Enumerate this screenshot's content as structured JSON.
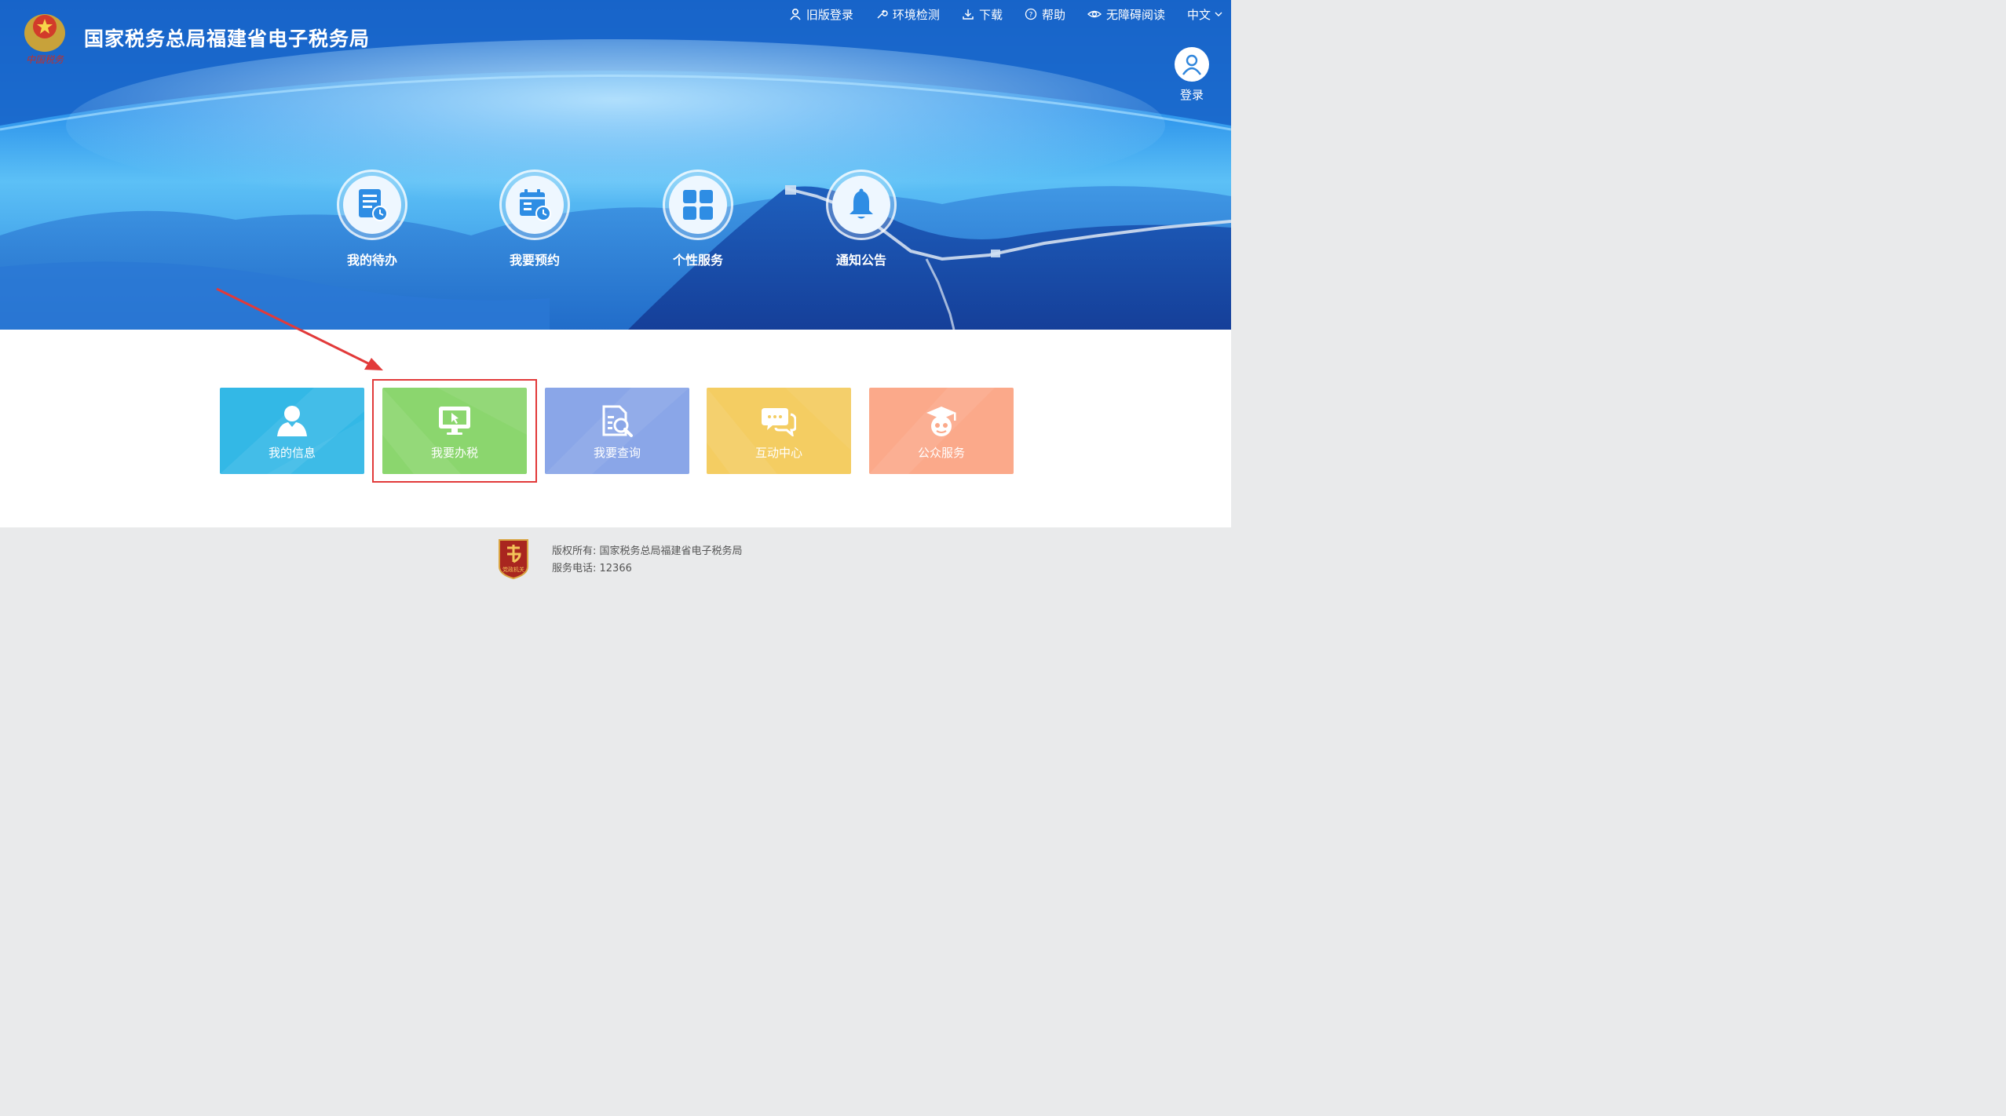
{
  "header": {
    "site_title": "国家税务总局福建省电子税务局",
    "logo_caption": "中国税务"
  },
  "topnav": {
    "old_login": "旧版登录",
    "env_check": "环境检测",
    "download": "下载",
    "help": "帮助",
    "accessibility": "无障碍阅读",
    "language": "中文"
  },
  "login": {
    "label": "登录"
  },
  "quick_links": [
    {
      "label": "我的待办",
      "icon": "todo-list-icon"
    },
    {
      "label": "我要预约",
      "icon": "calendar-clock-icon"
    },
    {
      "label": "个性服务",
      "icon": "grid-apps-icon"
    },
    {
      "label": "通知公告",
      "icon": "bell-icon"
    }
  ],
  "tiles": [
    {
      "label": "我的信息",
      "icon": "user-icon",
      "color": "#33b8e6"
    },
    {
      "label": "我要办税",
      "icon": "monitor-cursor-icon",
      "color": "#8bd66e"
    },
    {
      "label": "我要查询",
      "icon": "document-search-icon",
      "color": "#8aa6e8"
    },
    {
      "label": "互动中心",
      "icon": "chat-bubbles-icon",
      "color": "#f4cd62"
    },
    {
      "label": "公众服务",
      "icon": "graduate-face-icon",
      "color": "#fba98a"
    }
  ],
  "annotation": {
    "color": "#e23a3a",
    "highlighted_tile": "我要办税"
  },
  "footer": {
    "copyright": "版权所有: 国家税务总局福建省电子税务局",
    "phone": "服务电话: 12366",
    "badge_text": "党政机关"
  }
}
